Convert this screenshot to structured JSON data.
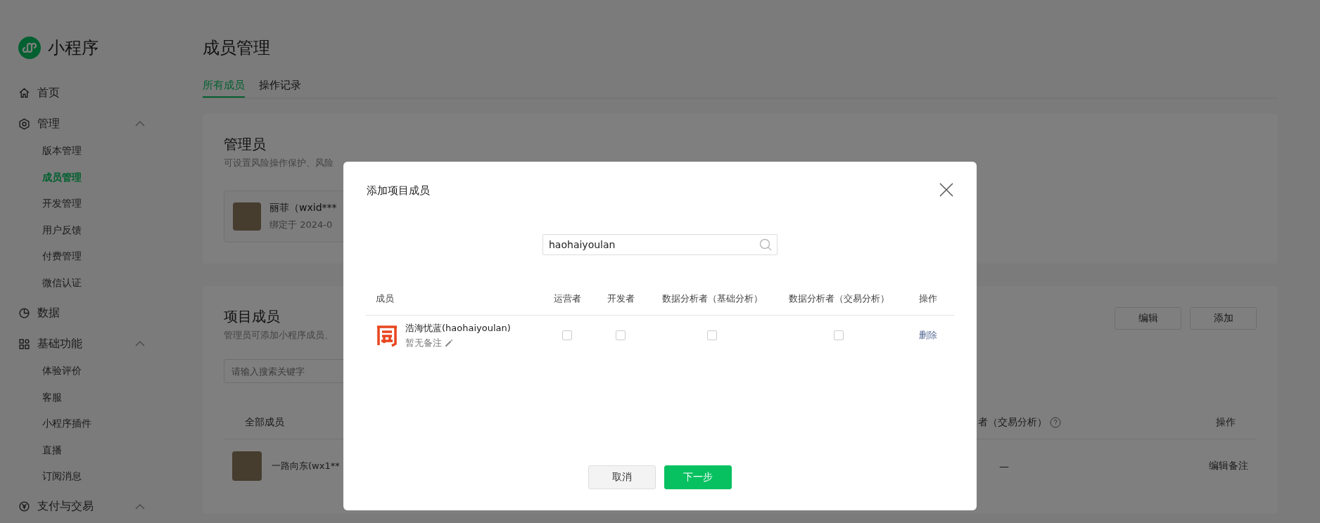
{
  "sidebar": {
    "brand": "小程序",
    "items": [
      {
        "label": "首页"
      },
      {
        "label": "管理",
        "expanded": true,
        "children": [
          {
            "label": "版本管理",
            "selected": false
          },
          {
            "label": "成员管理",
            "selected": true
          },
          {
            "label": "开发管理",
            "selected": false
          },
          {
            "label": "用户反馈",
            "selected": false
          },
          {
            "label": "付费管理",
            "selected": false
          },
          {
            "label": "微信认证",
            "selected": false
          }
        ]
      },
      {
        "label": "数据"
      },
      {
        "label": "基础功能",
        "expanded": true,
        "children": [
          {
            "label": "体验评价",
            "selected": false
          },
          {
            "label": "客服",
            "selected": false
          },
          {
            "label": "小程序插件",
            "selected": false
          },
          {
            "label": "直播",
            "selected": false
          },
          {
            "label": "订阅消息",
            "selected": false
          }
        ]
      },
      {
        "label": "支付与交易",
        "expanded": true
      }
    ]
  },
  "main": {
    "title": "成员管理",
    "tabs": [
      {
        "label": "所有成员",
        "selected": true
      },
      {
        "label": "操作记录",
        "selected": false
      }
    ],
    "admin_card": {
      "title": "管理员",
      "description": "可设置风险操作保护、风险",
      "admin": {
        "name": "丽菲（wxid***",
        "bound": "绑定于 2024-0"
      }
    },
    "project_card": {
      "title": "项目成员",
      "description": "管理员可添加小程序成员、",
      "buttons": [
        "编辑",
        "添加"
      ],
      "search": {
        "placeholder": "请输入搜索关键字"
      },
      "table": {
        "columns": [
          {
            "label": "全部成员"
          },
          {
            "label": "者（交易分析）",
            "help": true
          },
          {
            "label": "操作"
          }
        ],
        "rows": [
          {
            "name": "一路向东(wx1**",
            "value": "—",
            "action": "编辑备注"
          }
        ]
      }
    }
  },
  "modal": {
    "title": "添加项目成员",
    "search": {
      "value": "haohaiyoulan"
    },
    "columns": [
      "成员",
      "运营者",
      "开发者",
      "数据分析者（基础分析）",
      "数据分析者（交易分析）",
      "操作"
    ],
    "members": [
      {
        "name": "浩海忧蓝(haohaiyoulan)",
        "note": "暂无备注",
        "roles": [
          {
            "checked": false
          },
          {
            "checked": false
          },
          {
            "checked": false
          },
          {
            "checked": false
          }
        ],
        "action": "删除"
      }
    ],
    "buttons": [
      {
        "label": "取消",
        "kind": "secondary"
      },
      {
        "label": "下一步",
        "kind": "primary"
      }
    ]
  }
}
